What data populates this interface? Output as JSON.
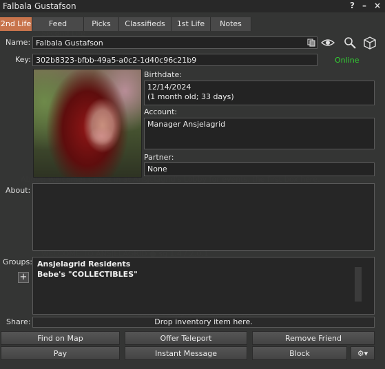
{
  "window": {
    "title": "Falbala Gustafson",
    "help_glyph": "?",
    "minimize_glyph": "–",
    "close_glyph": "×"
  },
  "tabs": [
    {
      "label": "2nd Life",
      "active": true
    },
    {
      "label": "Feed"
    },
    {
      "label": "Picks"
    },
    {
      "label": "Classifieds"
    },
    {
      "label": "1st Life"
    },
    {
      "label": "Notes"
    }
  ],
  "profile": {
    "name_label": "Name:",
    "name_value": "Falbala Gustafson",
    "key_label": "Key:",
    "key_value": "302b8323-bfbb-49a5-a0c2-1d40c96c21b9",
    "status": "Online",
    "birthdate_label": "Birthdate:",
    "birthdate_value": "12/14/2024",
    "birthdate_age": "(1 month old; 33 days)",
    "account_label": "Account:",
    "account_value": "Manager Ansjelagrid",
    "partner_label": "Partner:",
    "partner_value": "None",
    "about_label": "About:",
    "about_value": "",
    "groups_label": "Groups:",
    "groups": [
      "Ansjelagrid Residents",
      "Bebe's \"COLLECTIBLES\""
    ],
    "share_label": "Share:",
    "share_drop": "Drop inventory item here."
  },
  "buttons": {
    "find_on_map": "Find on Map",
    "offer_teleport": "Offer Teleport",
    "remove_friend": "Remove Friend",
    "pay": "Pay",
    "instant_message": "Instant Message",
    "block": "Block",
    "gear": "⚙▾"
  },
  "icons": {
    "copy": "copy-icon",
    "eye": "eye-icon",
    "magnifier": "magnifier-icon",
    "cube": "cube-icon"
  },
  "colors": {
    "accent_tab": "#c8744c",
    "online": "#33cc33"
  }
}
